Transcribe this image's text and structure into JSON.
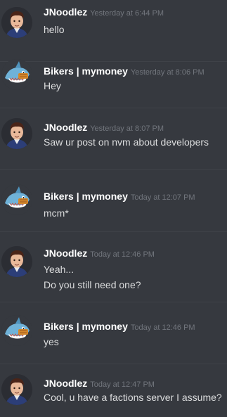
{
  "messages": [
    {
      "author": "JNoodlez",
      "avatar": "user-face-avatar",
      "time": "Yesterday at 6:44 PM",
      "lines": [
        "hello"
      ]
    },
    {
      "author": "Bikers | mymoney",
      "avatar": "shark-avatar",
      "time": "Yesterday at 8:06 PM",
      "lines": [
        "Hey"
      ]
    },
    {
      "author": "JNoodlez",
      "avatar": "user-face-avatar",
      "time": "Yesterday at 8:07 PM",
      "lines": [
        "Saw ur post on nvm about developers"
      ]
    },
    {
      "author": "Bikers | mymoney",
      "avatar": "shark-avatar",
      "time": "Today at 12:07 PM",
      "lines": [
        "mcm*"
      ]
    },
    {
      "author": "JNoodlez",
      "avatar": "user-face-avatar",
      "time": "Today at 12:46 PM",
      "lines": [
        "Yeah...",
        "Do you still need one?"
      ]
    },
    {
      "author": "Bikers | mymoney",
      "avatar": "shark-avatar",
      "time": "Today at 12:46 PM",
      "lines": [
        "yes"
      ]
    },
    {
      "author": "JNoodlez",
      "avatar": "user-face-avatar",
      "time": "Today at 12:47 PM",
      "lines": [
        "Cool, u have a factions server I assume?"
      ]
    }
  ],
  "colors": {
    "background": "#36393f",
    "author": "#ffffff",
    "timestamp": "#72767d",
    "text": "#dcddde"
  }
}
